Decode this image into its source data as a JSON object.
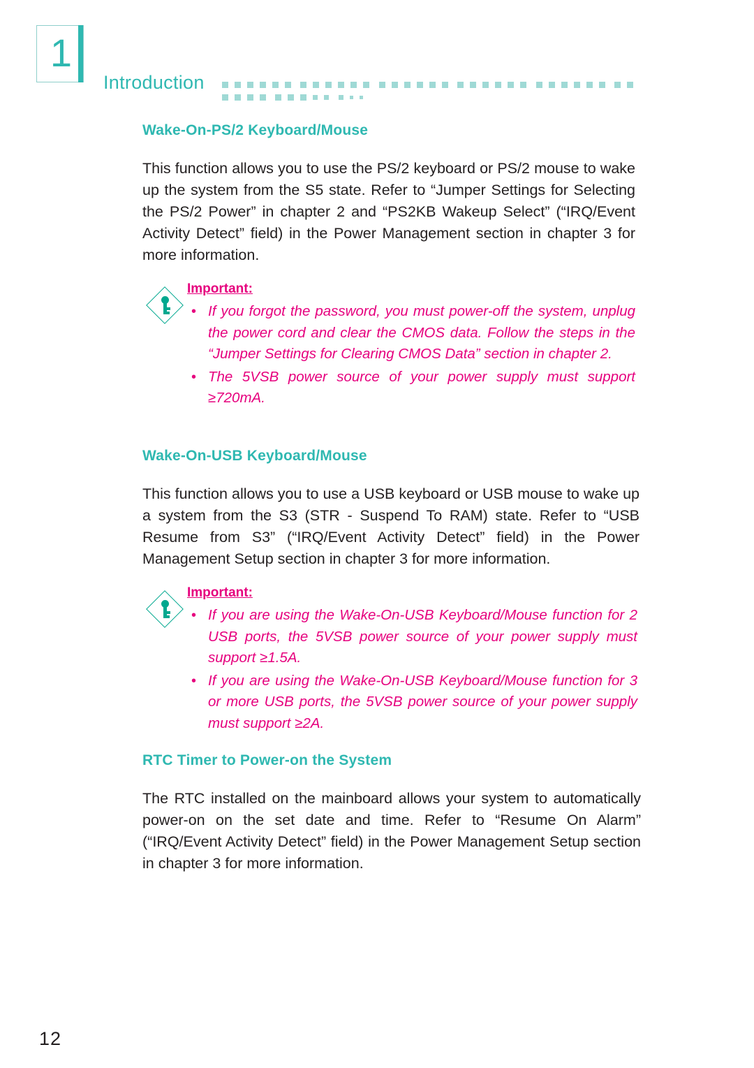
{
  "header": {
    "chapter_number": "1",
    "title": "Introduction",
    "accent_color": "#2fb8b1"
  },
  "sections": [
    {
      "heading": "Wake-On-PS/2 Keyboard/Mouse",
      "body": "This function allows you to use the PS/2 keyboard or PS/2 mouse to wake up the system from the S5 state. Refer to “Jumper Settings for Selecting the PS/2 Power” in chapter 2 and “PS2KB Wakeup Select” (“IRQ/Event Activity Detect” field) in the Power Management section in chapter 3 for more information.",
      "important": {
        "label": "Important:",
        "icon": "key-diamond-icon",
        "bullets": [
          "If you forgot the password, you must power-off the system, unplug the power cord and clear the CMOS data. Follow the steps in the “Jumper Settings for Clearing CMOS Data” section in chapter 2.",
          "The 5VSB power source of your power supply must support ≥720mA."
        ]
      }
    },
    {
      "heading": "Wake-On-USB Keyboard/Mouse",
      "body": "This function allows you to use a USB keyboard or USB mouse to wake up a system from the S3 (STR - Suspend To RAM) state. Refer to “USB Resume from S3” (“IRQ/Event Activity Detect” field) in the Power Management Setup section in chapter 3 for more information.",
      "important": {
        "label": "Important:",
        "icon": "key-diamond-icon",
        "bullets": [
          "If you are using the Wake-On-USB Keyboard/Mouse function for 2 USB ports, the 5VSB power source of your power supply must support ≥1.5A.",
          "If you are using the Wake-On-USB Keyboard/Mouse function for 3 or more USB ports, the 5VSB power source of your power supply must support ≥2A."
        ]
      }
    },
    {
      "heading": "RTC Timer to Power-on the System",
      "body": "The RTC installed on the mainboard allows your system to automatically power-on on the set date and time. Refer to “Resume On Alarm” (“IRQ/Event Activity Detect” field) in the Power Management Setup section in chapter 3 for more information."
    }
  ],
  "footer": {
    "page_number": "12"
  }
}
